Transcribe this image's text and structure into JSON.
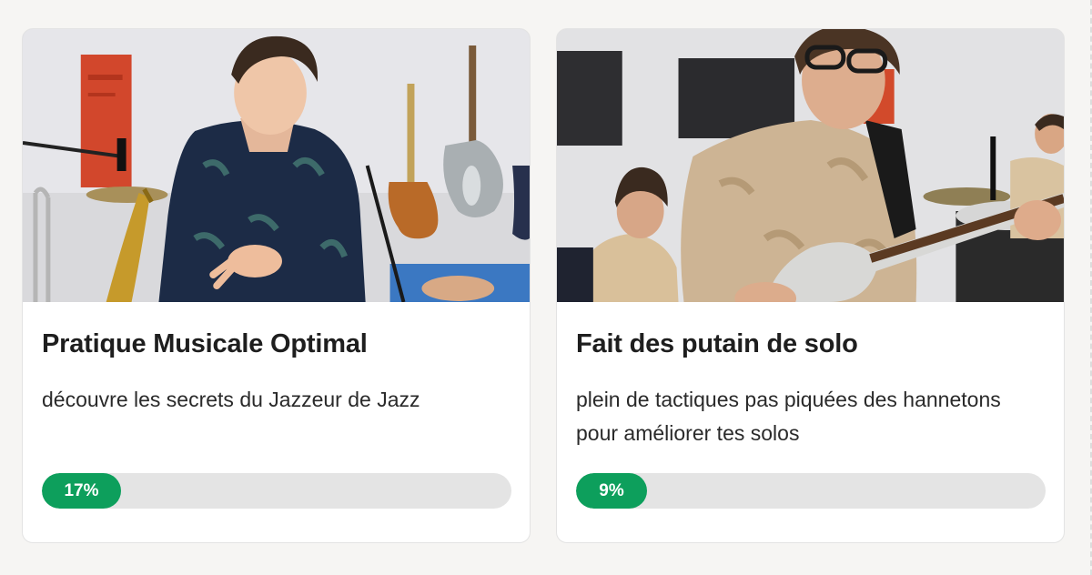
{
  "courses": [
    {
      "title": "Pratique Musicale Optimal",
      "description": "découvre les secrets du Jazzeur de Jazz",
      "progress_label": "17%",
      "progress": 0.17,
      "thumbnail_alt": "Jeune musicien en chemise à fleurs bleue devant des guitares et un saxophone"
    },
    {
      "title": "Fait des putain de solo",
      "description": "plein de tactiques pas piquées des hannetons pour améliorer tes solos",
      "progress_label": "9%",
      "progress": 0.09,
      "thumbnail_alt": "Jeune bassiste à lunettes jouant en répétition avec un pianiste et un batteur"
    }
  ],
  "colors": {
    "progress_fill": "#0d9f5c",
    "progress_track": "#e4e4e4",
    "card_background": "#ffffff",
    "page_background": "#f6f5f3"
  }
}
